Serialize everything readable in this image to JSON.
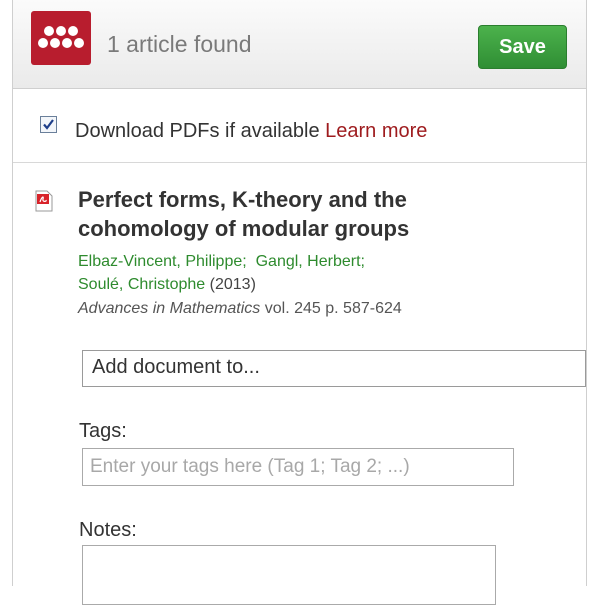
{
  "header": {
    "results_text": "1 article found",
    "save_label": "Save",
    "logo_icon": "mendeley-logo-icon",
    "brand_color": "#b81d2e",
    "save_color": "#3aa040"
  },
  "download_option": {
    "label": "Download PDFs if available",
    "link_label": "Learn more",
    "checked": true
  },
  "article": {
    "icon": "pdf-icon",
    "title": "Perfect forms, K-theory and the cohomology of modular groups",
    "authors": [
      "Elbaz-Vincent, Philippe;",
      "Gangl, Herbert;",
      "Soulé, Christophe"
    ],
    "year": "(2013)",
    "journal": "Advances in Mathematics",
    "volume_pages": "vol. 245 p. 587-624"
  },
  "add_document": {
    "label": "Add document to..."
  },
  "tags": {
    "label": "Tags:",
    "placeholder": "Enter your tags here (Tag 1; Tag 2; ...)"
  },
  "notes": {
    "label": "Notes:"
  }
}
